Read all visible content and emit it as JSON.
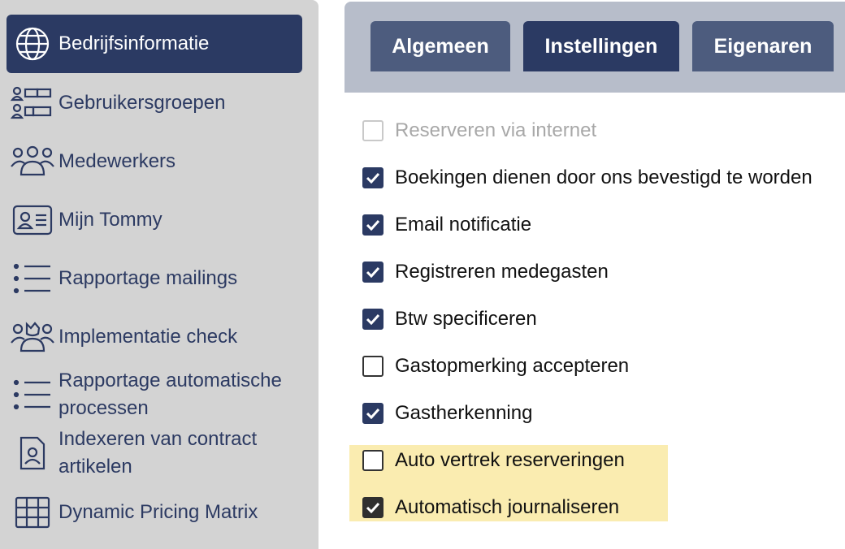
{
  "sidebar": {
    "items": [
      {
        "label": "Bedrijfsinformatie",
        "icon": "globe-icon",
        "active": true
      },
      {
        "label": "Gebruikersgroepen",
        "icon": "user-groups-icon"
      },
      {
        "label": "Medewerkers",
        "icon": "people-icon"
      },
      {
        "label": "Mijn Tommy",
        "icon": "id-card-icon"
      },
      {
        "label": "Rapportage mailings",
        "icon": "list-icon"
      },
      {
        "label": "Implementatie check",
        "icon": "people-check-icon"
      },
      {
        "label": "Rapportage automatische processen",
        "icon": "list-icon"
      },
      {
        "label": "Indexeren van contract artikelen",
        "icon": "contract-icon"
      },
      {
        "label": "Dynamic Pricing Matrix",
        "icon": "grid-icon"
      }
    ]
  },
  "tabs": [
    {
      "label": "Algemeen"
    },
    {
      "label": "Instellingen",
      "active": true
    },
    {
      "label": "Eigenaren"
    }
  ],
  "options": [
    {
      "label": "Reserveren via internet",
      "checked": false,
      "disabled": true
    },
    {
      "label": "Boekingen dienen door ons bevestigd te worden",
      "checked": true
    },
    {
      "label": "Email notificatie",
      "checked": true
    },
    {
      "label": "Registreren medegasten",
      "checked": true
    },
    {
      "label": "Btw specificeren",
      "checked": true
    },
    {
      "label": "Gastopmerking accepteren",
      "checked": false
    },
    {
      "label": "Gastherkenning",
      "checked": true
    },
    {
      "label": "Auto vertrek reserveringen",
      "checked": false,
      "highlighted": true
    },
    {
      "label": "Automatisch journaliseren",
      "checked": true,
      "highlighted": true
    }
  ],
  "colors": {
    "accent": "#2b3a63",
    "tab": "#4d5c7e",
    "sidebar": "#d3d3d3",
    "highlight": "#faecb0"
  }
}
